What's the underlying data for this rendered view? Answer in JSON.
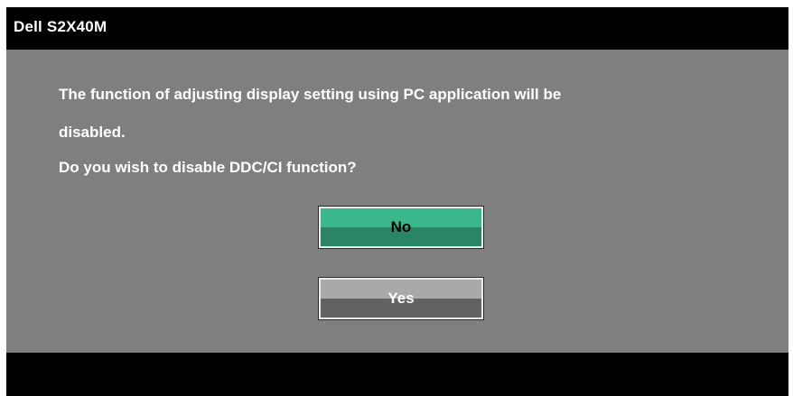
{
  "window": {
    "title": "Dell S2X40M"
  },
  "dialog": {
    "message_line1": "The function of adjusting display setting using PC application will be",
    "message_line2": "disabled.",
    "message_line3": "Do you wish to disable DDC/CI function?"
  },
  "buttons": {
    "no_label": "No",
    "yes_label": "Yes"
  },
  "colors": {
    "title_bar": "#000000",
    "content_bg": "#7f7f7f",
    "no_button_top": "#39b88c",
    "no_button_bottom": "#2a8567",
    "yes_button_top": "#a9a9a9",
    "yes_button_bottom": "#626262",
    "text": "#ffffff"
  }
}
